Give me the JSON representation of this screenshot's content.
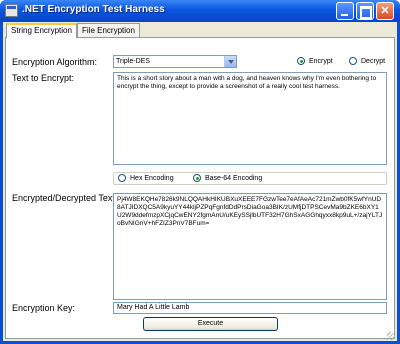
{
  "window": {
    "title": ".NET Encryption Test Harness",
    "accent_color": "#0a4fd6"
  },
  "tabs": [
    {
      "label": "String Encryption",
      "active": true
    },
    {
      "label": "File Encryption",
      "active": false
    }
  ],
  "form": {
    "algorithm_label": "Encryption Algorithm:",
    "algorithm_value": "Triple-DES",
    "mode_encrypt": "Encrypt",
    "mode_decrypt": "Decrypt",
    "mode_selected": "Encrypt",
    "text_to_encrypt_label": "Text to Encrypt:",
    "text_to_encrypt": "This is a short story about a man with a dog, and heaven knows why I'm even bothering to encrypt the thing, except to provide a screenshot of a really cool test harness.",
    "encoding_hex": "Hex Encoding",
    "encoding_base64": "Base-64 Encoding",
    "encoding_selected": "Base-64 Encoding",
    "output_label": "Encrypted/Decrypted Text:",
    "output_text": "Pj4W8EKQHe7826k9NLQQAHkHIKUBXuXEEE7FGzwTee7eAfAeAc721mZwb0fK5wfYnUD8ATJIDXQC5A9kyuYY44kljPZPqFgnfdDdPrsDiaGoa3BIK/zUMfjDTPSCevMa9bZKE6bXY1U2W9ddefmzpXCjqCwENY2fgmAnU/uKEySSjlbUTF32H7GhSxAGGhqyxx8kp9uL+/zajYLTJoBvNIGnV+hFZIZ3PnV7BFum=",
    "key_label": "Encryption Key:",
    "key_value": "Mary Had A Little Lamb",
    "execute_label": "Execute"
  }
}
